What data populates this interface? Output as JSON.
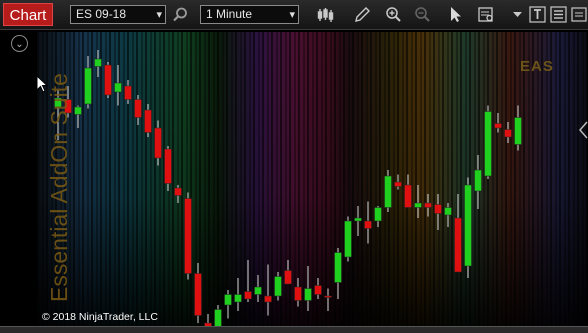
{
  "toolbar": {
    "chart_tab": "Chart",
    "instrument": "ES 09-18",
    "interval": "1 Minute"
  },
  "chart": {
    "copyright": "© 2018 NinjaTrader, LLC",
    "watermark_vertical": "Essential AddOn Suite",
    "watermark_corner": "EAS",
    "colors": {
      "up": "#1fd01f",
      "down": "#e01010",
      "wick": "#d8d8d8",
      "tab": "#b71c1c"
    },
    "candles": [
      {
        "o": 62,
        "h": 73,
        "l": 40,
        "c": 68
      },
      {
        "o": 67,
        "h": 76,
        "l": 55,
        "c": 58
      },
      {
        "o": 57,
        "h": 63,
        "l": 48,
        "c": 62
      },
      {
        "o": 64,
        "h": 96,
        "l": 61,
        "c": 88
      },
      {
        "o": 89,
        "h": 100,
        "l": 82,
        "c": 94
      },
      {
        "o": 90,
        "h": 92,
        "l": 68,
        "c": 70
      },
      {
        "o": 72,
        "h": 90,
        "l": 63,
        "c": 78
      },
      {
        "o": 76,
        "h": 80,
        "l": 64,
        "c": 67
      },
      {
        "o": 67,
        "h": 70,
        "l": 50,
        "c": 55
      },
      {
        "o": 60,
        "h": 64,
        "l": 42,
        "c": 45
      },
      {
        "o": 48,
        "h": 53,
        "l": 23,
        "c": 28
      },
      {
        "o": 34,
        "h": 36,
        "l": 6,
        "c": 11
      },
      {
        "o": 8,
        "h": 10,
        "l": -2,
        "c": 3
      },
      {
        "o": 1,
        "h": 5,
        "l": -53,
        "c": -49
      },
      {
        "o": -49,
        "h": -42,
        "l": -82,
        "c": -77
      },
      {
        "o": -82,
        "h": -76,
        "l": -86,
        "c": -85
      },
      {
        "o": -85,
        "h": -70,
        "l": -88,
        "c": -73
      },
      {
        "o": -70,
        "h": -60,
        "l": -79,
        "c": -63
      },
      {
        "o": -68,
        "h": -52,
        "l": -74,
        "c": -63
      },
      {
        "o": -61,
        "h": -40,
        "l": -68,
        "c": -66
      },
      {
        "o": -63,
        "h": -50,
        "l": -68,
        "c": -58
      },
      {
        "o": -64,
        "h": -43,
        "l": -77,
        "c": -68
      },
      {
        "o": -64,
        "h": -48,
        "l": -67,
        "c": -51
      },
      {
        "o": -47,
        "h": -40,
        "l": -54,
        "c": -56
      },
      {
        "o": -58,
        "h": -52,
        "l": -71,
        "c": -67
      },
      {
        "o": -67,
        "h": -44,
        "l": -74,
        "c": -59
      },
      {
        "o": -57,
        "h": -52,
        "l": -66,
        "c": -63
      },
      {
        "o": -64,
        "h": -59,
        "l": -74,
        "c": -65
      },
      {
        "o": -55,
        "h": -32,
        "l": -66,
        "c": -35
      },
      {
        "o": -38,
        "h": -11,
        "l": -41,
        "c": -14
      },
      {
        "o": -14,
        "h": -4,
        "l": -24,
        "c": -12
      },
      {
        "o": -14,
        "h": -1,
        "l": -29,
        "c": -19
      },
      {
        "o": -14,
        "h": -4,
        "l": -18,
        "c": -5
      },
      {
        "o": -5,
        "h": 20,
        "l": -8,
        "c": 16
      },
      {
        "o": 12,
        "h": 17,
        "l": 7,
        "c": 9
      },
      {
        "o": 10,
        "h": 17,
        "l": -5,
        "c": -5
      },
      {
        "o": -5,
        "h": 10,
        "l": -12,
        "c": -2
      },
      {
        "o": -2,
        "h": 4,
        "l": -11,
        "c": -5
      },
      {
        "o": -3,
        "h": 4,
        "l": -20,
        "c": -9
      },
      {
        "o": -10,
        "h": -2,
        "l": -18,
        "c": -5
      },
      {
        "o": -12,
        "h": 4,
        "l": -45,
        "c": -48
      },
      {
        "o": -44,
        "h": 15,
        "l": -52,
        "c": 10
      },
      {
        "o": 6,
        "h": 30,
        "l": -6,
        "c": 20
      },
      {
        "o": 16,
        "h": 63,
        "l": 14,
        "c": 59
      },
      {
        "o": 51,
        "h": 58,
        "l": 45,
        "c": 48
      },
      {
        "o": 47,
        "h": 52,
        "l": 38,
        "c": 42
      },
      {
        "o": 37,
        "h": 63,
        "l": 33,
        "c": 55
      }
    ]
  }
}
